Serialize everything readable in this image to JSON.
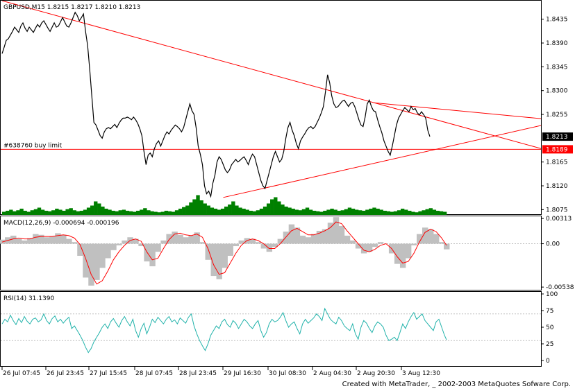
{
  "window": {
    "symbol_header": "GBPUSD,M15  1.8215  1.8217  1.8210  1.8213",
    "footer": "Created with MetaTrader, _ 2002-2003 MetaQuotes Sofware Corp."
  },
  "colors": {
    "price": "#000000",
    "volume": "#008000",
    "macd_hist": "#c0c0c0",
    "macd_signal": "#ff0000",
    "rsi": "#20b2aa",
    "trendline": "#ff0000",
    "frame": "#000000"
  },
  "chart_data": [
    {
      "type": "line",
      "panel": "price",
      "title": "GBPUSD,M15  1.8215  1.8217  1.8210  1.8213",
      "ylim": [
        1.8065,
        1.847
      ],
      "y_ticks": [
        "1.8435",
        "1.8390",
        "1.8345",
        "1.8300",
        "1.8255",
        "1.8165",
        "1.8120",
        "1.8075"
      ],
      "current_price": "1.8213",
      "order_level": {
        "label": "#638760 buy limit",
        "value": "1.8189",
        "level": 1.8189
      },
      "x_ticks": [
        "26 Jul 07:45",
        "26 Jul 23:45",
        "27 Jul 15:45",
        "28 Jul 07:45",
        "28 Jul 23:45",
        "29 Jul 16:30",
        "30 Jul 08:30",
        "2 Aug 04:30",
        "2 Aug 20:30",
        "3 Aug 12:30"
      ],
      "x": [
        0,
        3,
        6,
        9,
        12,
        15,
        18,
        21,
        24,
        27,
        30,
        33,
        36,
        39,
        42,
        45,
        48,
        51,
        54,
        57,
        60,
        63,
        66,
        69,
        72,
        75,
        78,
        81,
        84,
        87,
        90,
        93,
        96,
        99,
        102,
        105,
        108,
        111,
        114,
        117,
        120,
        123,
        126,
        129,
        132,
        135,
        138,
        141,
        144,
        147,
        150,
        153,
        156,
        159,
        162,
        165,
        168,
        171,
        174,
        177,
        180,
        183,
        186,
        189,
        192,
        195,
        198,
        201,
        204,
        207,
        210,
        213,
        216,
        219,
        222,
        225,
        228,
        231,
        234,
        237,
        240,
        243,
        246,
        249,
        252,
        255,
        258,
        261,
        264,
        267,
        270,
        273,
        276,
        279,
        282,
        285,
        288,
        291,
        294,
        297,
        300,
        303,
        306,
        309,
        312,
        315,
        318,
        321,
        324,
        327,
        330,
        333,
        336,
        339,
        342,
        345,
        348,
        351,
        354,
        357,
        360,
        363,
        366,
        369,
        372,
        375,
        378,
        381,
        384,
        387,
        390,
        393,
        396,
        399,
        402,
        405,
        408,
        411,
        414,
        417,
        420,
        423,
        426,
        429,
        432,
        435,
        438,
        441,
        444,
        447,
        450,
        453,
        456,
        459,
        462,
        465,
        468,
        471,
        474,
        477,
        480,
        483,
        486,
        489,
        492,
        495,
        498,
        501,
        504,
        507,
        510,
        513,
        516,
        519,
        522,
        525,
        528,
        531,
        534,
        537,
        540,
        543,
        546,
        549,
        552,
        555,
        558,
        561,
        564,
        567,
        570,
        573,
        576,
        579,
        582,
        585,
        588,
        591,
        594,
        597,
        600,
        603,
        606,
        609,
        612,
        615,
        618,
        621,
        624,
        627,
        630,
        633,
        636,
        639
      ],
      "values": [
        1.837,
        1.8382,
        1.8395,
        1.8398,
        1.8405,
        1.8412,
        1.842,
        1.8415,
        1.841,
        1.8422,
        1.8428,
        1.8418,
        1.8412,
        1.842,
        1.8415,
        1.841,
        1.8418,
        1.8425,
        1.842,
        1.8428,
        1.8432,
        1.8425,
        1.8418,
        1.8412,
        1.842,
        1.8428,
        1.842,
        1.8422,
        1.843,
        1.8438,
        1.843,
        1.8422,
        1.842,
        1.8428,
        1.8438,
        1.8448,
        1.8442,
        1.8432,
        1.8438,
        1.8445,
        1.8412,
        1.8385,
        1.834,
        1.829,
        1.824,
        1.8235,
        1.8225,
        1.8215,
        1.821,
        1.8222,
        1.8228,
        1.823,
        1.8228,
        1.8232,
        1.8236,
        1.823,
        1.8238,
        1.8244,
        1.8248,
        1.8248,
        1.825,
        1.8248,
        1.8245,
        1.825,
        1.8245,
        1.8238,
        1.8228,
        1.8215,
        1.8185,
        1.816,
        1.8178,
        1.8182,
        1.8175,
        1.819,
        1.82,
        1.8205,
        1.8195,
        1.8205,
        1.8215,
        1.8222,
        1.8218,
        1.8225,
        1.823,
        1.8235,
        1.8232,
        1.8228,
        1.8222,
        1.823,
        1.8245,
        1.826,
        1.8275,
        1.8262,
        1.8255,
        1.823,
        1.8195,
        1.818,
        1.816,
        1.812,
        1.8105,
        1.811,
        1.81,
        1.8125,
        1.814,
        1.8165,
        1.8175,
        1.817,
        1.816,
        1.815,
        1.8145,
        1.815,
        1.816,
        1.8165,
        1.817,
        1.8165,
        1.8168,
        1.8172,
        1.8175,
        1.8168,
        1.816,
        1.8172,
        1.818,
        1.8175,
        1.816,
        1.8145,
        1.813,
        1.812,
        1.8115,
        1.813,
        1.8145,
        1.816,
        1.8175,
        1.8185,
        1.8175,
        1.8165,
        1.817,
        1.8185,
        1.821,
        1.823,
        1.824,
        1.8225,
        1.8215,
        1.82,
        1.819,
        1.8205,
        1.8212,
        1.8218,
        1.8225,
        1.823,
        1.8232,
        1.8228,
        1.8232,
        1.824,
        1.8248,
        1.8258,
        1.827,
        1.8298,
        1.833,
        1.8315,
        1.829,
        1.8275,
        1.8268,
        1.827,
        1.8275,
        1.828,
        1.8282,
        1.8276,
        1.827,
        1.8276,
        1.8278,
        1.827,
        1.8258,
        1.8245,
        1.8235,
        1.8232,
        1.825,
        1.8275,
        1.8282,
        1.827,
        1.8262,
        1.826,
        1.8245,
        1.8232,
        1.822,
        1.8205,
        1.8195,
        1.8185,
        1.8178,
        1.8195,
        1.8215,
        1.8235,
        1.8248,
        1.8255,
        1.8262,
        1.8268,
        1.8264,
        1.826,
        1.827,
        1.8264,
        1.8266,
        1.8258,
        1.8254,
        1.826,
        1.8255,
        1.8248,
        1.8225,
        1.8213
      ],
      "trendlines": [
        {
          "from": [
            0,
            1.847
          ],
          "to": [
            815,
            1.8176
          ]
        },
        {
          "from": [
            318,
            1.8098
          ],
          "to": [
            815,
            1.8246
          ]
        },
        {
          "from": [
            535,
            1.8277
          ],
          "to": [
            815,
            1.8242
          ]
        }
      ]
    },
    {
      "type": "bar",
      "panel": "volume",
      "values": [
        6,
        8,
        10,
        7,
        9,
        12,
        8,
        6,
        9,
        11,
        14,
        10,
        8,
        7,
        9,
        12,
        10,
        8,
        11,
        13,
        9,
        7,
        8,
        10,
        14,
        18,
        26,
        22,
        16,
        12,
        10,
        8,
        7,
        9,
        10,
        8,
        7,
        6,
        8,
        10,
        13,
        9,
        7,
        6,
        5,
        6,
        8,
        7,
        6,
        9,
        12,
        15,
        18,
        24,
        30,
        38,
        28,
        22,
        18,
        14,
        12,
        10,
        12,
        16,
        20,
        26,
        18,
        14,
        12,
        10,
        8,
        7,
        9,
        12,
        16,
        22,
        30,
        34,
        26,
        20,
        16,
        14,
        12,
        10,
        9,
        11,
        14,
        10,
        8,
        7,
        6,
        8,
        10,
        12,
        10,
        8,
        9,
        11,
        14,
        12,
        10,
        9,
        8,
        10,
        12,
        14,
        12,
        10,
        8,
        7,
        6,
        7,
        9,
        12,
        10,
        8,
        6,
        5,
        7,
        9,
        11,
        13,
        10,
        8,
        7,
        6
      ]
    },
    {
      "type": "line",
      "panel": "macd",
      "title": "MACD(12,26,9)  -0.000694  -0.000196",
      "ylim": [
        -0.0058,
        0.0034
      ],
      "y_ticks": [
        "0.00313",
        "0.00",
        "-0.00538"
      ],
      "x": [
        0,
        8,
        16,
        24,
        32,
        40,
        48,
        56,
        64,
        72,
        80,
        88,
        96,
        104,
        112,
        120,
        128,
        136,
        144,
        152,
        160,
        168,
        176,
        184,
        192,
        200,
        208,
        216,
        224,
        232,
        240,
        248,
        256,
        264,
        272,
        280,
        288,
        296,
        304,
        312,
        320,
        328,
        336,
        344,
        352,
        360,
        368,
        376,
        384,
        392,
        400,
        408,
        416,
        424,
        432,
        440,
        448,
        456,
        464,
        472,
        480,
        488,
        496,
        504,
        512,
        520,
        528,
        536,
        544,
        552,
        560,
        568,
        576,
        584,
        592,
        600,
        608,
        616,
        624,
        632,
        639
      ],
      "histogram": [
        0.0005,
        0.0008,
        0.001,
        0.0006,
        0.0004,
        0.0007,
        0.0012,
        0.0011,
        0.0008,
        0.0009,
        0.0013,
        0.0011,
        0.0006,
        0.0002,
        -0.0015,
        -0.0042,
        -0.0052,
        -0.0045,
        -0.003,
        -0.0018,
        -0.0008,
        -0.0002,
        0.0004,
        0.0008,
        0.0006,
        -0.0003,
        -0.0022,
        -0.0028,
        -0.001,
        0.0004,
        0.0012,
        0.0015,
        0.0011,
        0.0008,
        0.001,
        0.0014,
        0.0002,
        -0.002,
        -0.004,
        -0.0044,
        -0.003,
        -0.0015,
        -0.0003,
        0.0004,
        0.0007,
        0.0006,
        0.0002,
        -0.0006,
        -0.001,
        -0.0004,
        0.0006,
        0.0015,
        0.0024,
        0.002,
        0.001,
        0.0008,
        0.0012,
        0.0016,
        0.0018,
        0.0026,
        0.0033,
        0.0022,
        0.001,
        0.0004,
        -0.0006,
        -0.0012,
        -0.001,
        -0.0004,
        0.0002,
        0.0,
        -0.0012,
        -0.0025,
        -0.003,
        -0.0018,
        -0.0002,
        0.0012,
        0.002,
        0.0018,
        0.0012,
        0.0002,
        -0.0007
      ],
      "signal": [
        0.0002,
        0.0004,
        0.0006,
        0.0007,
        0.0006,
        0.0006,
        0.0008,
        0.0009,
        0.0009,
        0.0009,
        0.001,
        0.0011,
        0.001,
        0.0007,
        -0.0001,
        -0.0018,
        -0.0038,
        -0.005,
        -0.0046,
        -0.0034,
        -0.002,
        -0.001,
        -0.0002,
        0.0004,
        0.0006,
        0.0003,
        -0.001,
        -0.002,
        -0.0018,
        -0.0006,
        0.0005,
        0.0012,
        0.0013,
        0.0011,
        0.001,
        0.0012,
        0.0008,
        -0.0006,
        -0.0026,
        -0.0038,
        -0.0036,
        -0.0024,
        -0.0012,
        -0.0002,
        0.0004,
        0.0006,
        0.0004,
        0.0,
        -0.0006,
        -0.0006,
        0.0,
        0.0008,
        0.0016,
        0.0019,
        0.0015,
        0.0011,
        0.0011,
        0.0013,
        0.0016,
        0.002,
        0.0027,
        0.0025,
        0.0016,
        0.0008,
        0.0,
        -0.0008,
        -0.001,
        -0.0007,
        -0.0002,
        0.0,
        -0.0006,
        -0.0016,
        -0.0024,
        -0.0022,
        -0.0012,
        0.0002,
        0.0014,
        0.0018,
        0.0015,
        0.0007,
        -0.0002
      ]
    },
    {
      "type": "line",
      "panel": "rsi",
      "title": "RSI(14)  31.1390",
      "ylim": [
        0,
        100
      ],
      "y_ticks": [
        "100",
        "75",
        "50",
        "25",
        "0"
      ],
      "levels": [
        30,
        70
      ],
      "x": [
        0,
        4,
        8,
        12,
        16,
        20,
        24,
        28,
        32,
        36,
        40,
        44,
        48,
        52,
        56,
        60,
        64,
        68,
        72,
        76,
        80,
        84,
        88,
        92,
        96,
        100,
        104,
        108,
        112,
        116,
        120,
        124,
        128,
        132,
        136,
        140,
        144,
        148,
        152,
        156,
        160,
        164,
        168,
        172,
        176,
        180,
        184,
        188,
        192,
        196,
        200,
        204,
        208,
        212,
        216,
        220,
        224,
        228,
        232,
        236,
        240,
        244,
        248,
        252,
        256,
        260,
        264,
        268,
        272,
        276,
        280,
        284,
        288,
        292,
        296,
        300,
        304,
        308,
        312,
        316,
        320,
        324,
        328,
        332,
        336,
        340,
        344,
        348,
        352,
        356,
        360,
        364,
        368,
        372,
        376,
        380,
        384,
        388,
        392,
        396,
        400,
        404,
        408,
        412,
        416,
        420,
        424,
        428,
        432,
        436,
        440,
        444,
        448,
        452,
        456,
        460,
        464,
        468,
        472,
        476,
        480,
        484,
        488,
        492,
        496,
        500,
        504,
        508,
        512,
        516,
        520,
        524,
        528,
        532,
        536,
        540,
        544,
        548,
        552,
        556,
        560,
        564,
        568,
        572,
        576,
        580,
        584,
        588,
        592,
        596,
        600,
        604,
        608,
        612,
        616,
        620,
        624,
        628,
        632,
        636,
        639
      ],
      "values": [
        55,
        62,
        58,
        68,
        60,
        54,
        63,
        57,
        66,
        59,
        55,
        62,
        64,
        58,
        61,
        70,
        60,
        55,
        63,
        67,
        58,
        62,
        56,
        61,
        65,
        48,
        52,
        45,
        38,
        30,
        20,
        12,
        18,
        28,
        35,
        42,
        50,
        55,
        48,
        58,
        63,
        56,
        50,
        60,
        66,
        58,
        52,
        62,
        45,
        35,
        48,
        56,
        40,
        50,
        62,
        57,
        65,
        60,
        55,
        62,
        66,
        58,
        61,
        55,
        64,
        60,
        56,
        65,
        70,
        52,
        40,
        30,
        22,
        15,
        25,
        38,
        45,
        52,
        48,
        58,
        62,
        54,
        50,
        60,
        56,
        48,
        55,
        62,
        58,
        52,
        48,
        55,
        60,
        45,
        35,
        42,
        55,
        62,
        58,
        60,
        65,
        72,
        60,
        50,
        55,
        58,
        48,
        40,
        55,
        62,
        56,
        60,
        64,
        70,
        66,
        60,
        78,
        70,
        62,
        58,
        55,
        65,
        60,
        52,
        48,
        45,
        55,
        40,
        32,
        50,
        60,
        56,
        48,
        42,
        52,
        58,
        55,
        50,
        38,
        30,
        32,
        35,
        30,
        42,
        55,
        48,
        58,
        66,
        72,
        62,
        66,
        70,
        60,
        55,
        50,
        45,
        58,
        62,
        50,
        38,
        31
      ]
    }
  ]
}
